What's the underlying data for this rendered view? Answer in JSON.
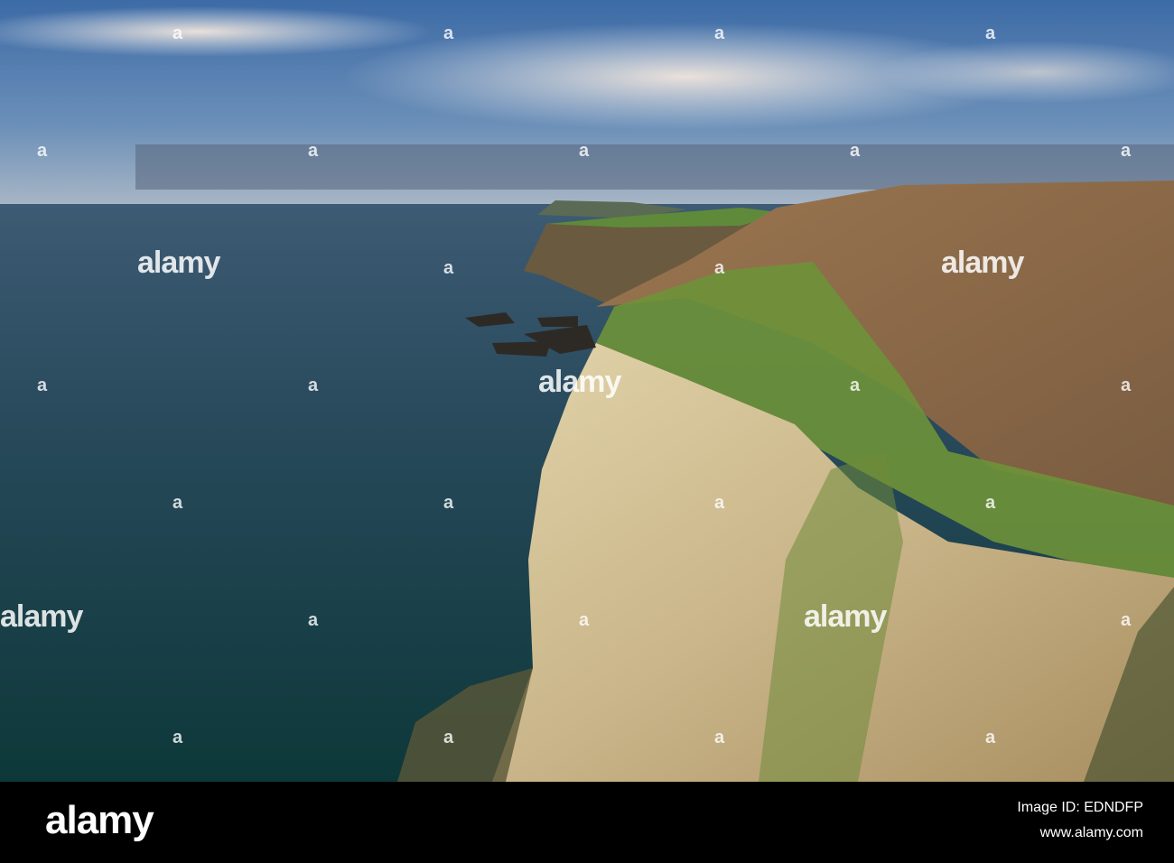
{
  "photo": {
    "subject": "sea-cliffs",
    "colors": {
      "sky_top": "#3f6ea8",
      "sky_horizon": "#9fb6cc",
      "sea_far": "#3b5a70",
      "sea_near": "#0f3a3e",
      "cliff_chalk": "#d8c49a",
      "cliff_basalt": "#8a6a4a",
      "grass": "#6f9a3a"
    }
  },
  "watermark": {
    "word": "alamy",
    "mark": "a"
  },
  "footer": {
    "logo": "alamy",
    "image_id": "Image ID: EDNDFP",
    "url": "www.alamy.com"
  }
}
